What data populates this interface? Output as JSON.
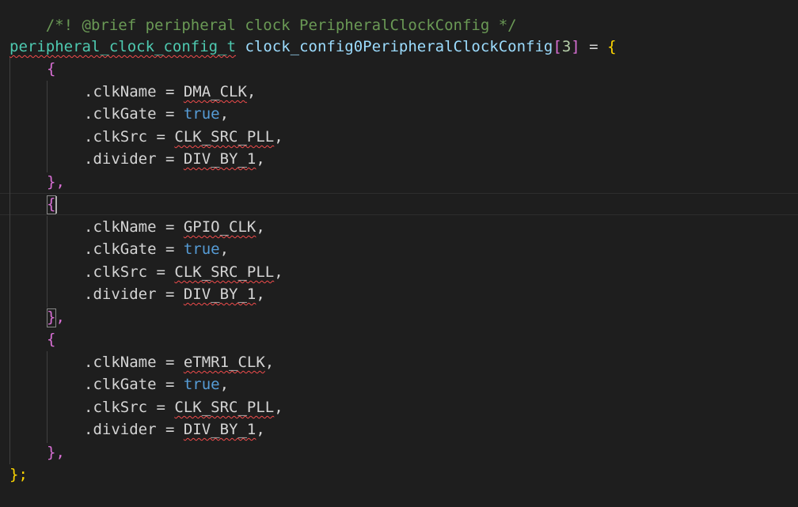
{
  "editor": {
    "comment_line": "/*! @brief peripheral clock PeripheralClockConfig */",
    "declaration": {
      "type": "peripheral_clock_config_t",
      "name": "clock_config0PeripheralClockConfig",
      "open_bracket": "[",
      "size": "3",
      "close_bracket": "]",
      "assign": " = ",
      "open_brace": "{"
    },
    "entries": [
      {
        "open": "{",
        "close": "},",
        "fields": [
          {
            "prefix": ".clkName = ",
            "value": "DMA_CLK",
            "value_kind": "macro",
            "suffix": ","
          },
          {
            "prefix": ".clkGate = ",
            "value": "true",
            "value_kind": "keyword",
            "suffix": ","
          },
          {
            "prefix": ".clkSrc = ",
            "value": "CLK_SRC_PLL",
            "value_kind": "macro",
            "suffix": ","
          },
          {
            "prefix": ".divider = ",
            "value": "DIV_BY_1",
            "value_kind": "macro",
            "suffix": ","
          }
        ]
      },
      {
        "open": "{",
        "close": "},",
        "fields": [
          {
            "prefix": ".clkName = ",
            "value": "GPIO_CLK",
            "value_kind": "macro",
            "suffix": ","
          },
          {
            "prefix": ".clkGate = ",
            "value": "true",
            "value_kind": "keyword",
            "suffix": ","
          },
          {
            "prefix": ".clkSrc = ",
            "value": "CLK_SRC_PLL",
            "value_kind": "macro",
            "suffix": ","
          },
          {
            "prefix": ".divider = ",
            "value": "DIV_BY_1",
            "value_kind": "macro",
            "suffix": ","
          }
        ]
      },
      {
        "open": "{",
        "close": "},",
        "fields": [
          {
            "prefix": ".clkName = ",
            "value": "eTMR1_CLK",
            "value_kind": "macro",
            "suffix": ","
          },
          {
            "prefix": ".clkGate = ",
            "value": "true",
            "value_kind": "keyword",
            "suffix": ","
          },
          {
            "prefix": ".clkSrc = ",
            "value": "CLK_SRC_PLL",
            "value_kind": "macro",
            "suffix": ","
          },
          {
            "prefix": ".divider = ",
            "value": "DIV_BY_1",
            "value_kind": "macro",
            "suffix": ","
          }
        ]
      }
    ],
    "closing": "};"
  },
  "colors": {
    "background": "#1e1e1e",
    "comment": "#6a9955",
    "type": "#4ec9b0",
    "identifier": "#9cdcfe",
    "number": "#b5cea8",
    "bracket_pink": "#da70d6",
    "brace_gold": "#ffd700",
    "keyword": "#569cd6",
    "error_squiggle": "#f14c4c"
  }
}
